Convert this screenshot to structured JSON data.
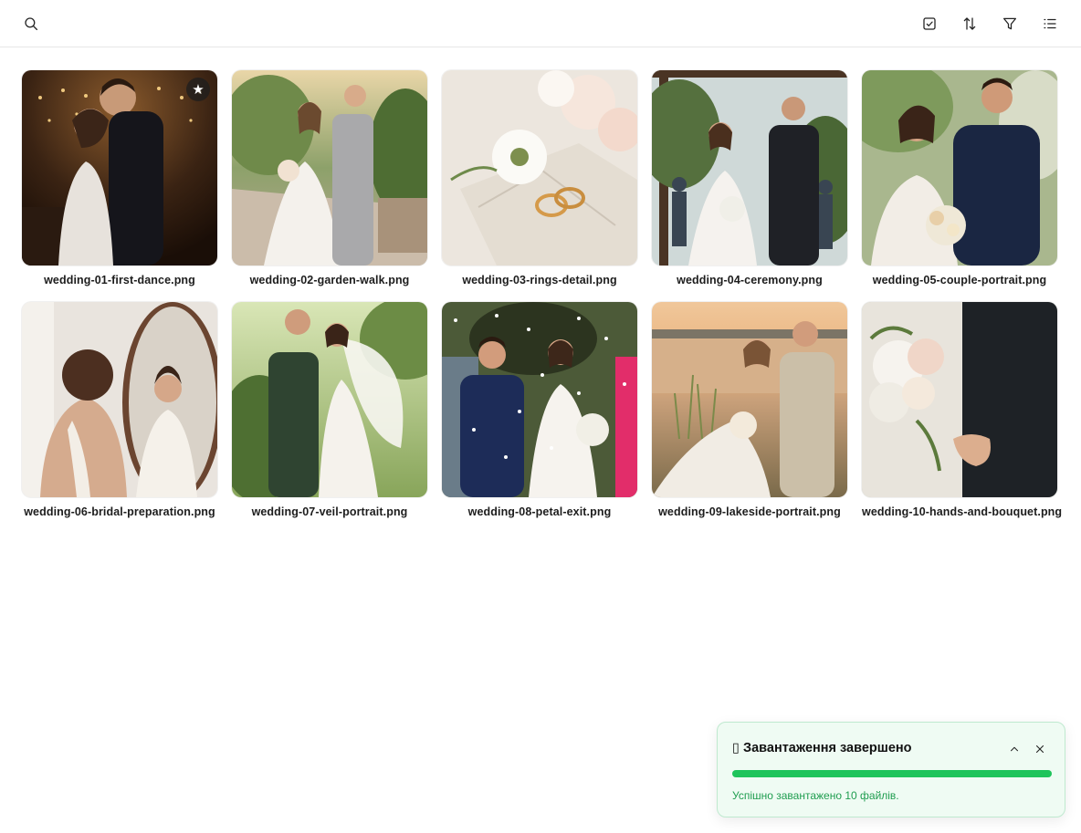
{
  "toolbar": {
    "icons": [
      "search-icon",
      "select-checkbox-icon",
      "sort-icon",
      "filter-icon",
      "list-view-icon"
    ]
  },
  "gallery": {
    "items": [
      {
        "filename": "wedding-01-first-dance.png",
        "starred": true
      },
      {
        "filename": "wedding-02-garden-walk.png",
        "starred": false
      },
      {
        "filename": "wedding-03-rings-detail.png",
        "starred": false
      },
      {
        "filename": "wedding-04-ceremony.png",
        "starred": false
      },
      {
        "filename": "wedding-05-couple-portrait.png",
        "starred": false
      },
      {
        "filename": "wedding-06-bridal-preparation.png",
        "starred": false
      },
      {
        "filename": "wedding-07-veil-portrait.png",
        "starred": false
      },
      {
        "filename": "wedding-08-petal-exit.png",
        "starred": false
      },
      {
        "filename": "wedding-09-lakeside-portrait.png",
        "starred": false
      },
      {
        "filename": "wedding-10-hands-and-bouquet.png",
        "starred": false
      }
    ]
  },
  "toast": {
    "title": "▯ Завантаження завершено",
    "message": "Успішно завантажено 10 файлів.",
    "progress_percent": 100,
    "colors": {
      "accent": "#1fc45b",
      "background": "#effbf3",
      "text": "#1f9d4f"
    }
  }
}
